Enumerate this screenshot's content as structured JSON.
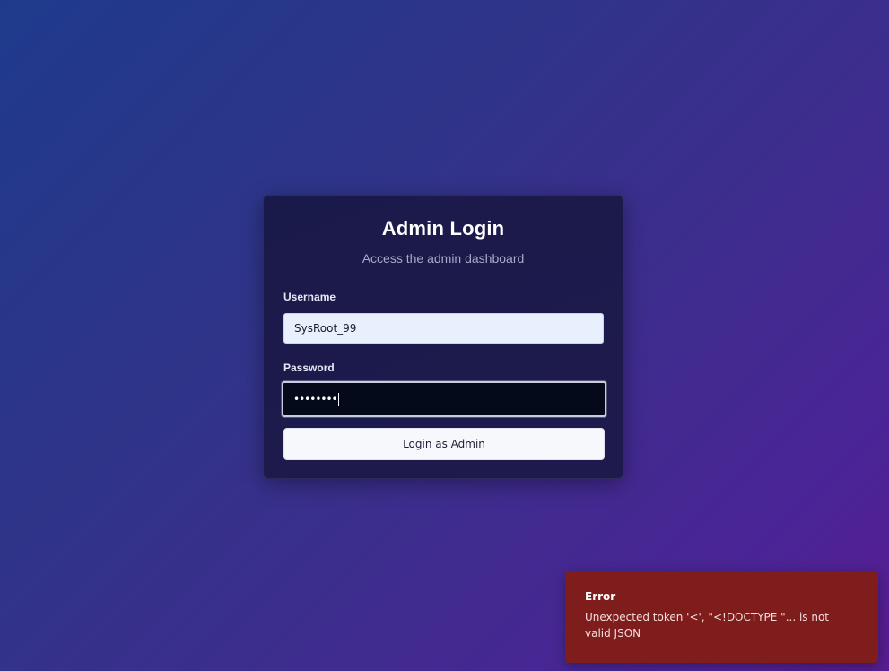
{
  "theme": {
    "background_start": "#1f3a8c",
    "background_end": "#581c8f",
    "card_background": "#1c1a4b",
    "error_background": "#7f1d1d"
  },
  "login_card": {
    "title": "Admin Login",
    "subtitle": "Access the admin dashboard",
    "username_label": "Username",
    "username_value": "SysRoot_99",
    "password_label": "Password",
    "password_masked": "••••••••",
    "submit_label": "Login as Admin"
  },
  "toast": {
    "title": "Error",
    "message": "Unexpected token '<', \"<!DOCTYPE \"... is not valid JSON"
  }
}
